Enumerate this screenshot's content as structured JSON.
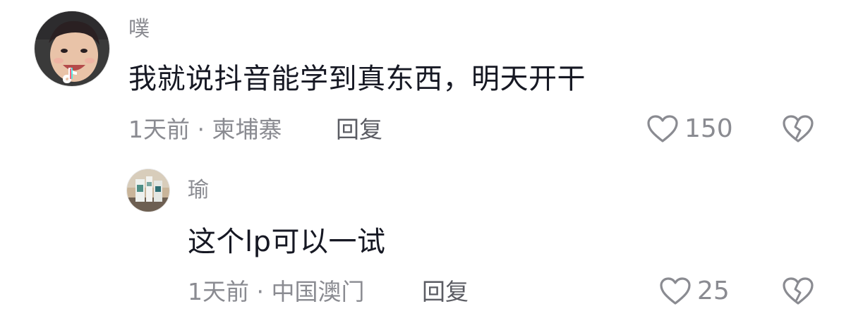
{
  "comments": [
    {
      "username": "噗",
      "text": "我就说抖音能学到真东西，明天开干",
      "time": "1天前 · 柬埔寨",
      "reply_label": "回复",
      "likes": "150",
      "avatar_icon": "child-photo-avatar"
    },
    {
      "username": "瑜",
      "text": "这个lp可以一试",
      "time": "1天前 · 中国澳门",
      "reply_label": "回复",
      "likes": "25",
      "avatar_icon": "product-photo-avatar"
    }
  ],
  "colors": {
    "text": "#161823",
    "secondary": "#8a8b91",
    "reply": "#5b5c63"
  }
}
